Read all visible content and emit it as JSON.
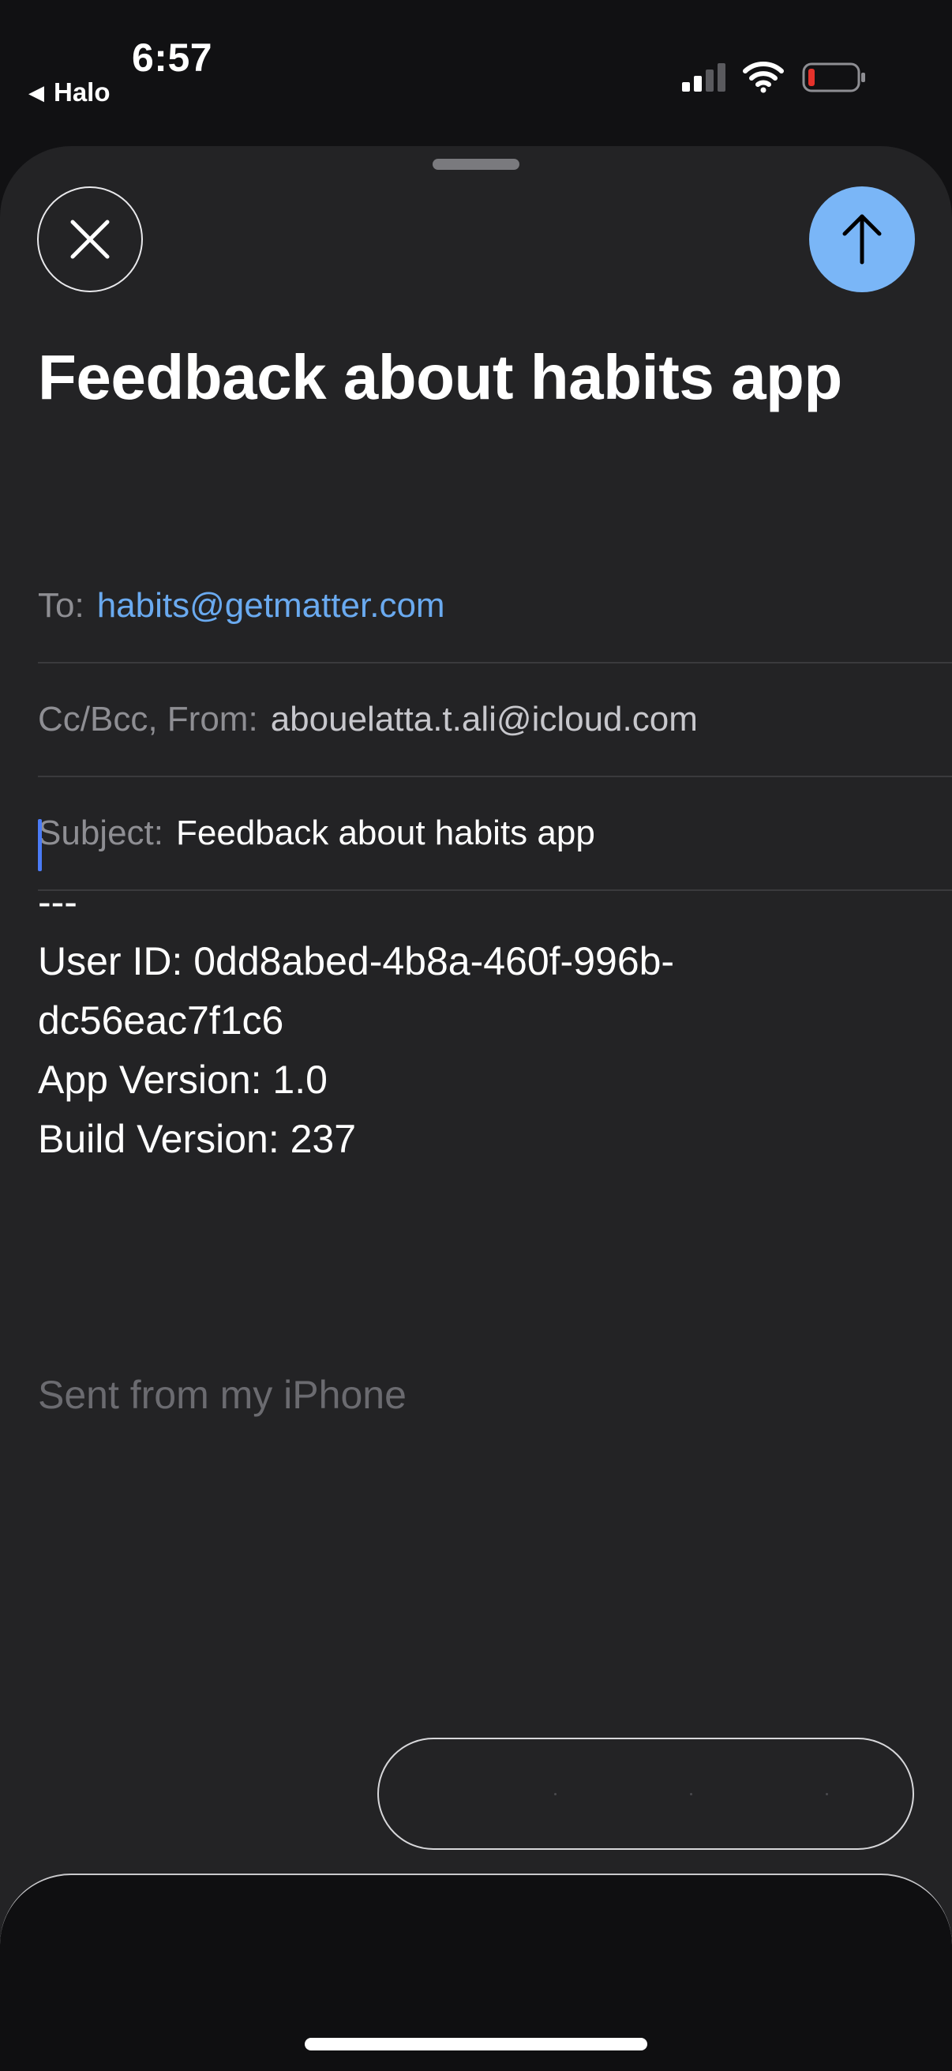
{
  "status_bar": {
    "time": "6:57",
    "back_app": "Halo",
    "icons": [
      "signal-icon",
      "wifi-icon",
      "battery-icon"
    ],
    "battery_color": "#e5322b"
  },
  "compose": {
    "title": "Feedback about habits app",
    "to_label": "To:",
    "to_value": "habits@getmatter.com",
    "ccbcc_label": "Cc/Bcc, From:",
    "from_value": "abouelatta.t.ali@icloud.com",
    "subject_label": "Subject:",
    "subject_value": "Feedback about habits app",
    "body": {
      "separator": "---",
      "user_id_line_1": "User ID: 0dd8abed-4b8a-460f-996b-",
      "user_id_line_2": "dc56eac7f1c6",
      "app_version": "App Version: 1.0",
      "build_version": "Build Version: 237"
    },
    "signature": "Sent from my iPhone"
  },
  "colors": {
    "accent_send": "#7ab6f7",
    "link": "#6aaaf0",
    "cursor": "#4a7bf7",
    "sheet_bg": "#232325"
  }
}
